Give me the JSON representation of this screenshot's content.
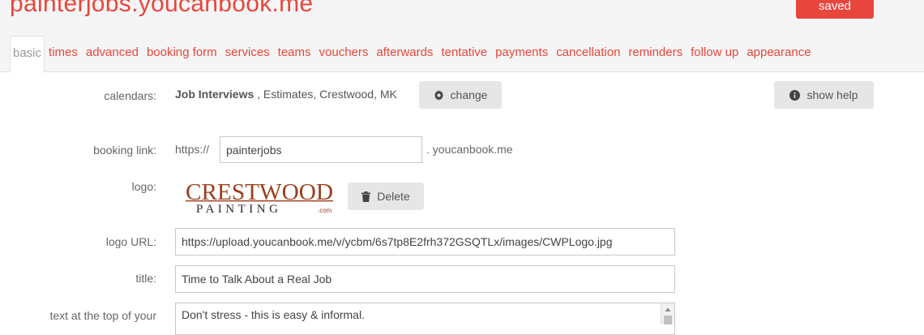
{
  "header": {
    "site_title": "painterjobs.youcanbook.me",
    "saved_label": "saved"
  },
  "tabs": [
    {
      "label": "basic",
      "active": true
    },
    {
      "label": "times"
    },
    {
      "label": "advanced"
    },
    {
      "label": "booking form"
    },
    {
      "label": "services"
    },
    {
      "label": "teams"
    },
    {
      "label": "vouchers"
    },
    {
      "label": "afterwards"
    },
    {
      "label": "tentative"
    },
    {
      "label": "payments"
    },
    {
      "label": "cancellation"
    },
    {
      "label": "reminders"
    },
    {
      "label": "follow up"
    },
    {
      "label": "appearance"
    }
  ],
  "calendars": {
    "label": "calendars:",
    "primary": "Job Interviews",
    "others": " , Estimates, Crestwood, MK",
    "change_label": "change",
    "change_icon": "gear-icon"
  },
  "help": {
    "label": "show help",
    "icon": "info-icon"
  },
  "booking_link": {
    "label": "booking link:",
    "prefix": "https://",
    "value": "painterjobs",
    "suffix": ". youcanbook.me"
  },
  "logo": {
    "label": "logo:",
    "logo_line1": "CRESTWOOD",
    "logo_line2": "PAINTING",
    "logo_suffix": ".com",
    "delete_label": "Delete",
    "delete_icon": "trash-icon"
  },
  "logo_url": {
    "label": "logo URL:",
    "value": "https://upload.youcanbook.me/v/ycbm/6s7tp8E2frh372GSQTLx/images/CWPLogo.jpg"
  },
  "title": {
    "label": "title:",
    "value": "Time to Talk About a Real Job"
  },
  "top_text": {
    "label": "text at the top of your",
    "value": "Don't stress - this is easy & informal."
  },
  "colors": {
    "accent": "#e8463c",
    "logo_brown": "#9c3f1c",
    "logo_dark": "#2b2b2b"
  }
}
